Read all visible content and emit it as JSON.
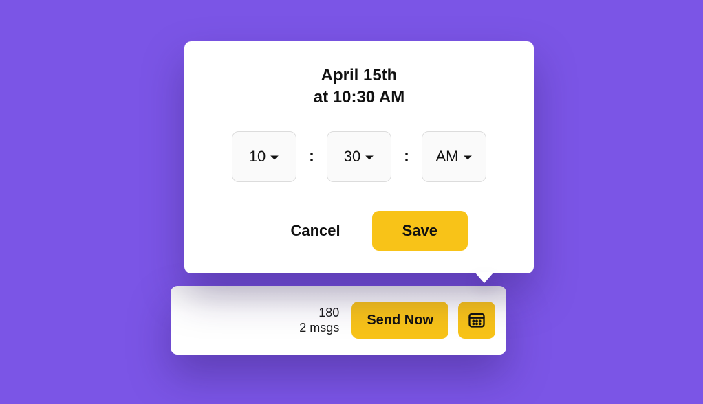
{
  "popover": {
    "heading_line1": "April 15th",
    "heading_line2": "at 10:30 AM",
    "hour": "10",
    "minute": "30",
    "period": "AM",
    "separator": ":",
    "cancel_label": "Cancel",
    "save_label": "Save"
  },
  "bottom_bar": {
    "count": "180",
    "msgs": "2 msgs",
    "send_label": "Send Now"
  },
  "colors": {
    "background": "#7b55e6",
    "accent": "#f8c318"
  }
}
